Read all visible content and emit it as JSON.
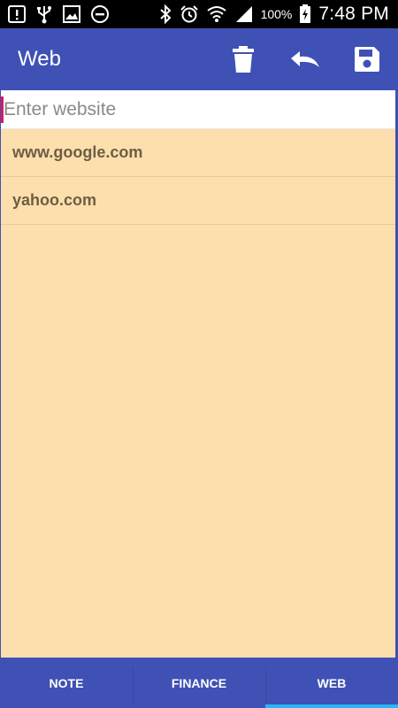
{
  "status_bar": {
    "left_icons": [
      "alert-icon",
      "usb-icon",
      "image-icon",
      "do-not-disturb-icon"
    ],
    "right_icons": [
      "bluetooth-icon",
      "alarm-icon",
      "wifi-icon",
      "signal-icon",
      "battery-charging-icon"
    ],
    "battery": "100%",
    "time": "7:48 PM"
  },
  "app_bar": {
    "title": "Web",
    "actions": [
      "delete-icon",
      "undo-icon",
      "save-icon"
    ]
  },
  "input": {
    "placeholder": "Enter website",
    "value": ""
  },
  "sites": [
    {
      "label": "www.google.com"
    },
    {
      "label": "yahoo.com"
    }
  ],
  "tabs": [
    {
      "label": "NOTE",
      "selected": false
    },
    {
      "label": "FINANCE",
      "selected": false
    },
    {
      "label": "WEB",
      "selected": true
    }
  ],
  "colors": {
    "primary": "#3f51b5",
    "content_bg": "#fddfad",
    "accent_cursor": "#d81b60",
    "tab_indicator": "#29b6f6"
  }
}
